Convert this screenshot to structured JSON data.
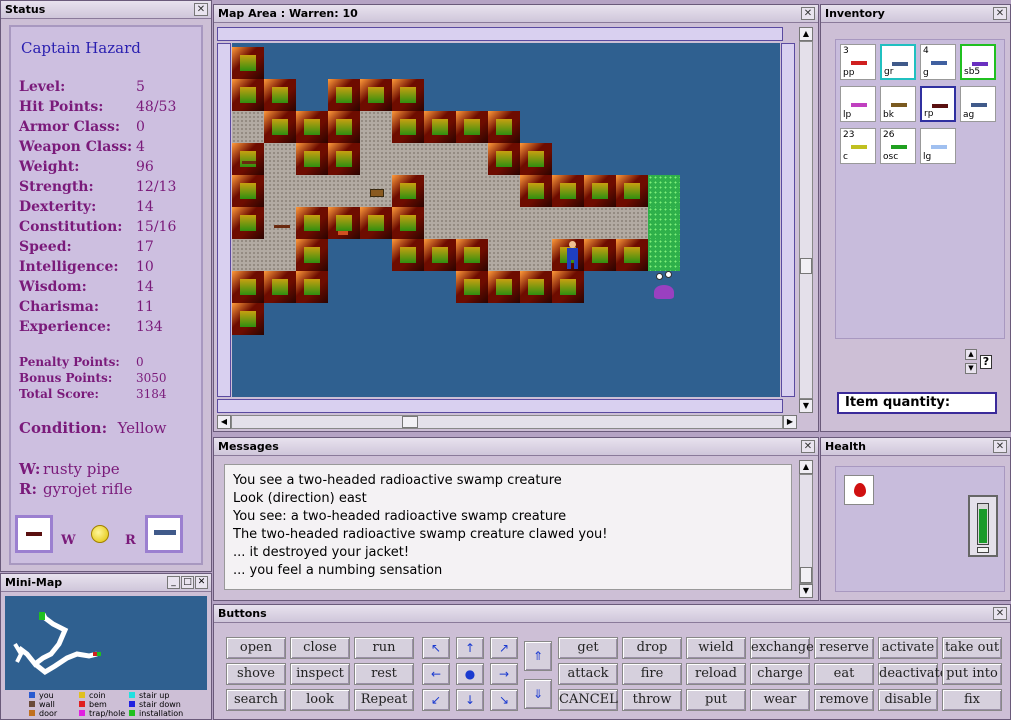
{
  "status": {
    "title": "Status",
    "char_name": "Captain Hazard",
    "stats": [
      {
        "label": "Level:",
        "value": "5"
      },
      {
        "label": "Hit Points:",
        "value": "48/53"
      },
      {
        "label": "Armor Class:",
        "value": "0"
      },
      {
        "label": "Weapon Class:",
        "value": "4"
      },
      {
        "label": "Weight:",
        "value": "96"
      },
      {
        "label": "Strength:",
        "value": "12/13"
      },
      {
        "label": "Dexterity:",
        "value": "14"
      },
      {
        "label": "Constitution:",
        "value": "15/16"
      },
      {
        "label": "Speed:",
        "value": "17"
      },
      {
        "label": "Intelligence:",
        "value": "10"
      },
      {
        "label": "Wisdom:",
        "value": "14"
      },
      {
        "label": "Charisma:",
        "value": "11"
      },
      {
        "label": "Experience:",
        "value": "134"
      }
    ],
    "points": [
      {
        "label": "Penalty Points:",
        "value": "0"
      },
      {
        "label": "Bonus Points:",
        "value": "3050"
      },
      {
        "label": "Total Score:",
        "value": "3184"
      }
    ],
    "condition_label": "Condition:",
    "condition_value": "Yellow",
    "w_label": "W:",
    "w_value": "rusty pipe",
    "r_label": "R:",
    "r_value": "gyrojet rifle",
    "slot_w": "W",
    "slot_r": "R"
  },
  "map": {
    "title": "Map Area : Warren: 10"
  },
  "inventory": {
    "title": "Inventory",
    "items": [
      {
        "qty": "3",
        "code": "pp"
      },
      {
        "qty": "",
        "code": "gr"
      },
      {
        "qty": "4",
        "code": "g"
      },
      {
        "qty": "",
        "code": "sb5"
      },
      {
        "qty": "",
        "code": "lp"
      },
      {
        "qty": "",
        "code": "bk"
      },
      {
        "qty": "",
        "code": "rp"
      },
      {
        "qty": "",
        "code": "ag"
      },
      {
        "qty": "23",
        "code": "c"
      },
      {
        "qty": "26",
        "code": "osc"
      },
      {
        "qty": "",
        "code": "lg"
      }
    ],
    "help": "?",
    "quantity_label": "Item quantity:"
  },
  "messages": {
    "title": "Messages",
    "lines": [
      "You see a two-headed radioactive swamp creature",
      "Look (direction) east",
      "You see:  a two-headed radioactive swamp creature",
      "The two-headed radioactive swamp creature clawed you!",
      "... it destroyed your jacket!",
      "... you feel a numbing sensation"
    ]
  },
  "health": {
    "title": "Health",
    "level": 0.85
  },
  "minimap": {
    "title": "Mini-Map",
    "legend": [
      {
        "label": "you",
        "color": "#2a5ad0"
      },
      {
        "label": "wall",
        "color": "#6a4a3a"
      },
      {
        "label": "door",
        "color": "#c07020"
      },
      {
        "label": "coin",
        "color": "#e0c020"
      },
      {
        "label": "bem",
        "color": "#e02020"
      },
      {
        "label": "trap/hole",
        "color": "#e020e0"
      },
      {
        "label": "stair up",
        "color": "#20e0e0"
      },
      {
        "label": "stair down",
        "color": "#2020e0"
      },
      {
        "label": "installation",
        "color": "#20c020"
      }
    ]
  },
  "buttons": {
    "title": "Buttons",
    "left": [
      [
        "open",
        "close",
        "run"
      ],
      [
        "shove",
        "inspect",
        "rest"
      ],
      [
        "search",
        "look",
        "Repeat"
      ]
    ],
    "right": [
      [
        "get",
        "drop",
        "wield",
        "exchange",
        "reserve",
        "activate",
        "take out"
      ],
      [
        "attack",
        "fire",
        "reload",
        "charge",
        "eat",
        "deactivate",
        "put into"
      ],
      [
        "CANCEL",
        "throw",
        "put",
        "wear",
        "remove",
        "disable",
        "fix"
      ]
    ]
  }
}
